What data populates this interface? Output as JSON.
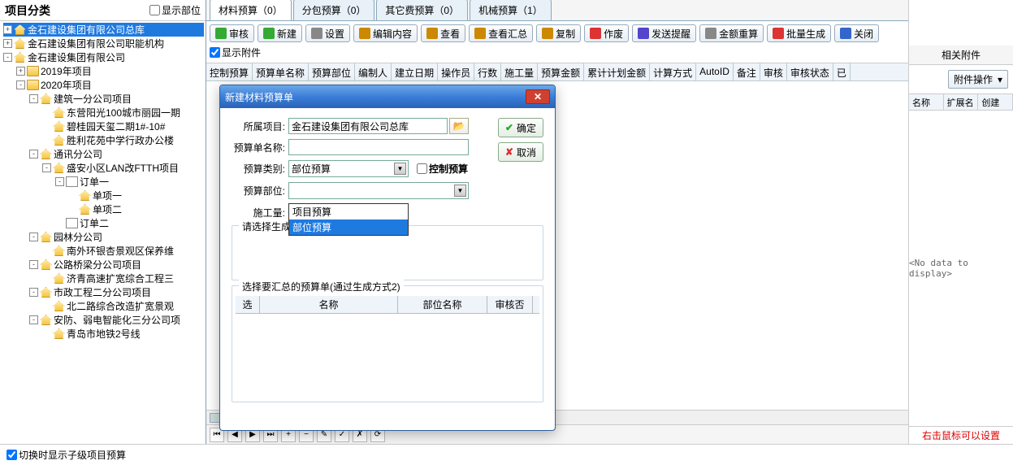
{
  "left": {
    "title": "项目分类",
    "show_parts": "显示部位",
    "bottom_check": "切换时显示子级项目预算",
    "tree": [
      {
        "indent": 0,
        "toggle": "+",
        "icon": "house",
        "label": "金石建设集团有限公司总库",
        "sel": true
      },
      {
        "indent": 0,
        "toggle": "+",
        "icon": "house",
        "label": "金石建设集团有限公司职能机构"
      },
      {
        "indent": 0,
        "toggle": "-",
        "icon": "house",
        "label": "金石建设集团有限公司"
      },
      {
        "indent": 1,
        "toggle": "+",
        "icon": "folder",
        "label": "2019年项目"
      },
      {
        "indent": 1,
        "toggle": "-",
        "icon": "folder",
        "label": "2020年项目"
      },
      {
        "indent": 2,
        "toggle": "-",
        "icon": "house",
        "label": "建筑一分公司项目"
      },
      {
        "indent": 3,
        "toggle": "",
        "icon": "house",
        "label": "东营阳光100城市丽园一期"
      },
      {
        "indent": 3,
        "toggle": "",
        "icon": "house",
        "label": "碧桂园天玺二期1#-10#"
      },
      {
        "indent": 3,
        "toggle": "",
        "icon": "house",
        "label": "胜利花苑中学行政办公楼"
      },
      {
        "indent": 2,
        "toggle": "-",
        "icon": "house",
        "label": "通讯分公司"
      },
      {
        "indent": 3,
        "toggle": "-",
        "icon": "house",
        "label": "盛安小区LAN改FTTH项目"
      },
      {
        "indent": 4,
        "toggle": "-",
        "icon": "doc",
        "label": "订单一"
      },
      {
        "indent": 5,
        "toggle": "",
        "icon": "house",
        "label": "单项一"
      },
      {
        "indent": 5,
        "toggle": "",
        "icon": "house",
        "label": "单项二"
      },
      {
        "indent": 4,
        "toggle": "",
        "icon": "doc",
        "label": "订单二"
      },
      {
        "indent": 2,
        "toggle": "-",
        "icon": "house",
        "label": "园林分公司"
      },
      {
        "indent": 3,
        "toggle": "",
        "icon": "house",
        "label": "南外环银杏景观区保养维"
      },
      {
        "indent": 2,
        "toggle": "-",
        "icon": "house",
        "label": "公路桥梁分公司项目"
      },
      {
        "indent": 3,
        "toggle": "",
        "icon": "house",
        "label": "济青高速扩宽综合工程三"
      },
      {
        "indent": 2,
        "toggle": "-",
        "icon": "house",
        "label": "市政工程二分公司项目"
      },
      {
        "indent": 3,
        "toggle": "",
        "icon": "house",
        "label": "北二路综合改造扩宽景观"
      },
      {
        "indent": 2,
        "toggle": "-",
        "icon": "house",
        "label": "安防、弱电智能化三分公司项"
      },
      {
        "indent": 3,
        "toggle": "",
        "icon": "house",
        "label": "青岛市地铁2号线"
      }
    ]
  },
  "tabs": [
    {
      "label": "材料预算（0）",
      "active": true
    },
    {
      "label": "分包预算（0）"
    },
    {
      "label": "其它费预算（0）"
    },
    {
      "label": "机械预算（1）"
    }
  ],
  "toolbar": [
    {
      "label": "审核",
      "c": "#3a3"
    },
    {
      "label": "新建",
      "c": "#3a3"
    },
    {
      "label": "设置",
      "c": "#888"
    },
    {
      "label": "编辑内容",
      "c": "#c80"
    },
    {
      "label": "查看",
      "c": "#c80"
    },
    {
      "label": "查看汇总",
      "c": "#c80"
    },
    {
      "label": "复制",
      "c": "#c80"
    },
    {
      "label": "作废",
      "c": "#d33"
    },
    {
      "label": "发送提醒",
      "c": "#54c"
    },
    {
      "label": "金额重算",
      "c": "#888"
    },
    {
      "label": "批量生成",
      "c": "#d33"
    },
    {
      "label": "关闭",
      "c": "#36c"
    }
  ],
  "show_attach_label": "显示附件",
  "grid_cols": [
    "控制预算",
    "预算单名称",
    "预算部位",
    "编制人",
    "建立日期",
    "操作员",
    "行数",
    "施工量",
    "预算金额",
    "累计计划金额",
    "计算方式",
    "AutoID",
    "备注",
    "审核",
    "审核状态",
    "已"
  ],
  "right": {
    "header": "相关附件",
    "ops": "附件操作",
    "cols": [
      "名称",
      "扩展名",
      "创建"
    ],
    "empty": "<No data to display>",
    "footer": "右击鼠标可以设置"
  },
  "dialog": {
    "title": "新建材料预算单",
    "project_lbl": "所属项目:",
    "project_val": "金石建设集团有限公司总库",
    "name_lbl": "预算单名称:",
    "type_lbl": "预算类别:",
    "type_val": "部位预算",
    "type_options": [
      "项目预算",
      "部位预算"
    ],
    "control_lbl": "控制预算",
    "part_lbl": "预算部位:",
    "qty_lbl": "施工量:",
    "method_lbl": "请选择生成方式:",
    "pick_lbl": "选择要汇总的预算单(通过生成方式2)",
    "mini_cols": [
      "选",
      "名称",
      "部位名称",
      "审核否"
    ],
    "ok": "确定",
    "cancel": "取消"
  }
}
